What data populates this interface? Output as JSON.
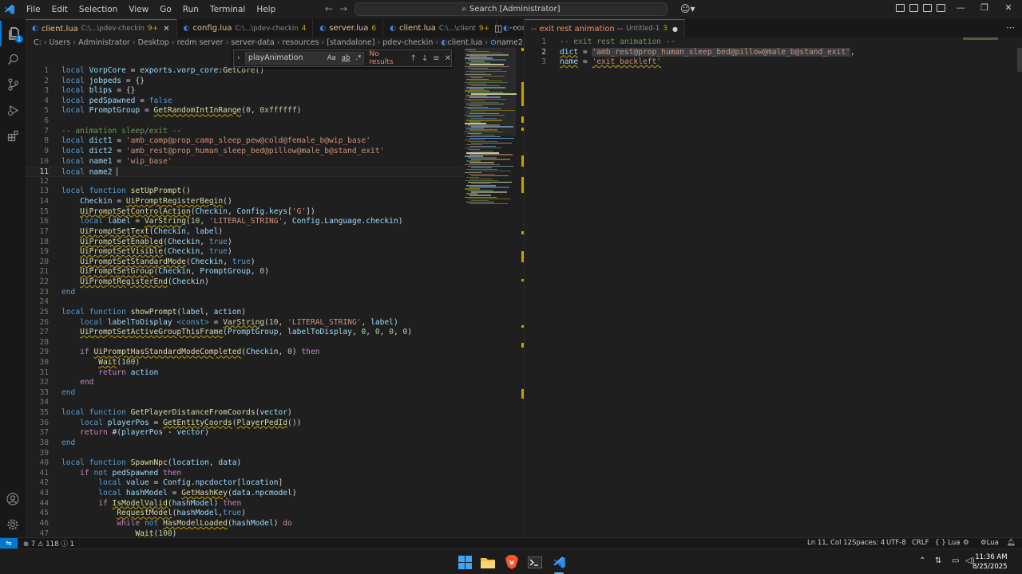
{
  "menu": [
    "File",
    "Edit",
    "Selection",
    "View",
    "Go",
    "Run",
    "Terminal",
    "Help"
  ],
  "search": {
    "text": "Search [Administrator]"
  },
  "activity": {
    "explorer_badge": "1"
  },
  "left_tabs": [
    {
      "name": "client.lua",
      "path": "C:\\...\\pdev-checkin",
      "badge": "9+",
      "active": true,
      "close": "✕"
    },
    {
      "name": "config.lua",
      "path": "C:\\...\\pdev-checkin",
      "badge": "4"
    },
    {
      "name": "server.lua",
      "path": "",
      "badge": "6"
    },
    {
      "name": "client.lua",
      "path": "C:\\...\\client",
      "badge": "9+"
    },
    {
      "name": "config.lua",
      "path": "",
      "badge": ""
    }
  ],
  "right_tab": {
    "name": "-- exit rest animation --",
    "path": "Untitled-1",
    "badge": "3"
  },
  "breadcrumb": [
    "C:",
    "Users",
    "Administrator",
    "Desktop",
    "redm server",
    "server-data",
    "resources",
    "[standalone]",
    "pdev-checkin",
    "client.lua",
    "name2"
  ],
  "find": {
    "query": "playAnimation",
    "opt_case": "Aa",
    "opt_word": "ab",
    "opt_regex": ".*",
    "result": "No results"
  },
  "left_code": [
    {
      "n": "1",
      "t": [
        [
          "k",
          "local "
        ],
        [
          "v",
          "VorpCore"
        ],
        [
          "w",
          " = "
        ],
        [
          "v",
          "exports"
        ],
        [
          "w",
          "."
        ],
        [
          "v",
          "vorp_core"
        ],
        [
          "w",
          ":"
        ],
        [
          "f",
          "GetCore"
        ],
        [
          "w",
          "()"
        ]
      ]
    },
    {
      "n": "2",
      "t": [
        [
          "k",
          "local "
        ],
        [
          "v",
          "jobpeds"
        ],
        [
          "w",
          " = {}"
        ]
      ]
    },
    {
      "n": "3",
      "t": [
        [
          "k",
          "local "
        ],
        [
          "v",
          "blips"
        ],
        [
          "w",
          " = {}"
        ]
      ]
    },
    {
      "n": "4",
      "t": [
        [
          "k",
          "local "
        ],
        [
          "v",
          "pedSpawned"
        ],
        [
          "w",
          " = "
        ],
        [
          "k",
          "false"
        ]
      ]
    },
    {
      "n": "5",
      "t": [
        [
          "k",
          "local "
        ],
        [
          "v",
          "PromptGroup"
        ],
        [
          "w",
          " = "
        ],
        [
          "fu",
          "GetRandomIntInRange"
        ],
        [
          "w",
          "("
        ],
        [
          "n",
          "0"
        ],
        [
          "w",
          ", "
        ],
        [
          "n",
          "0xffffff"
        ],
        [
          "w",
          ")"
        ]
      ]
    },
    {
      "n": "6",
      "t": []
    },
    {
      "n": "7",
      "t": [
        [
          "c",
          "-- animation sleep/exit --"
        ]
      ]
    },
    {
      "n": "8",
      "t": [
        [
          "k",
          "local "
        ],
        [
          "v",
          "dict1"
        ],
        [
          "w",
          " = "
        ],
        [
          "s",
          "'amb_camp@prop_camp_sleep_pew@cold@female_b@wip_base'"
        ]
      ]
    },
    {
      "n": "9",
      "t": [
        [
          "k",
          "local "
        ],
        [
          "v",
          "dict2"
        ],
        [
          "w",
          " = "
        ],
        [
          "s",
          "'amb_rest@prop_human_sleep_bed@pillow@male_b@stand_exit'"
        ]
      ]
    },
    {
      "n": "10",
      "t": [
        [
          "k",
          "local "
        ],
        [
          "v",
          "name1"
        ],
        [
          "w",
          " = "
        ],
        [
          "s",
          "'wip_base'"
        ]
      ]
    },
    {
      "n": "11",
      "t": [
        [
          "k",
          "local "
        ],
        [
          "v",
          "name2"
        ],
        [
          "w",
          " "
        ],
        [
          "cur",
          ""
        ]
      ],
      "current": true
    },
    {
      "n": "12",
      "t": []
    },
    {
      "n": "13",
      "t": [
        [
          "k",
          "local function "
        ],
        [
          "f",
          "setUpPrompt"
        ],
        [
          "w",
          "()"
        ]
      ]
    },
    {
      "n": "14",
      "t": [
        [
          "w",
          "    "
        ],
        [
          "v",
          "Checkin"
        ],
        [
          "w",
          " = "
        ],
        [
          "fu",
          "UiPromptRegisterBegin"
        ],
        [
          "w",
          "()"
        ]
      ]
    },
    {
      "n": "15",
      "t": [
        [
          "w",
          "    "
        ],
        [
          "fu",
          "UiPromptSetControlAction"
        ],
        [
          "w",
          "("
        ],
        [
          "v",
          "Checkin"
        ],
        [
          "w",
          ", "
        ],
        [
          "v",
          "Config"
        ],
        [
          "w",
          "."
        ],
        [
          "v",
          "keys"
        ],
        [
          "w",
          "["
        ],
        [
          "s",
          "'G'"
        ],
        [
          "w",
          "])"
        ]
      ]
    },
    {
      "n": "16",
      "t": [
        [
          "w",
          "    "
        ],
        [
          "k",
          "local "
        ],
        [
          "v",
          "label"
        ],
        [
          "w",
          " = "
        ],
        [
          "fu",
          "VarString"
        ],
        [
          "w",
          "("
        ],
        [
          "n",
          "10"
        ],
        [
          "w",
          ", "
        ],
        [
          "s",
          "'LITERAL_STRING'"
        ],
        [
          "w",
          ", "
        ],
        [
          "v",
          "Config"
        ],
        [
          "w",
          "."
        ],
        [
          "v",
          "Language"
        ],
        [
          "w",
          "."
        ],
        [
          "v",
          "checkin"
        ],
        [
          "w",
          ")"
        ]
      ]
    },
    {
      "n": "17",
      "t": [
        [
          "w",
          "    "
        ],
        [
          "fu",
          "UiPromptSetText"
        ],
        [
          "w",
          "("
        ],
        [
          "v",
          "Checkin"
        ],
        [
          "w",
          ", "
        ],
        [
          "v",
          "label"
        ],
        [
          "w",
          ")"
        ]
      ]
    },
    {
      "n": "18",
      "t": [
        [
          "w",
          "    "
        ],
        [
          "fu",
          "UiPromptSetEnabled"
        ],
        [
          "w",
          "("
        ],
        [
          "v",
          "Checkin"
        ],
        [
          "w",
          ", "
        ],
        [
          "k",
          "true"
        ],
        [
          "w",
          ")"
        ]
      ]
    },
    {
      "n": "19",
      "t": [
        [
          "w",
          "    "
        ],
        [
          "fu",
          "UiPromptSetVisible"
        ],
        [
          "w",
          "("
        ],
        [
          "v",
          "Checkin"
        ],
        [
          "w",
          ", "
        ],
        [
          "k",
          "true"
        ],
        [
          "w",
          ")"
        ]
      ]
    },
    {
      "n": "20",
      "t": [
        [
          "w",
          "    "
        ],
        [
          "fu",
          "UiPromptSetStandardMode"
        ],
        [
          "w",
          "("
        ],
        [
          "v",
          "Checkin"
        ],
        [
          "w",
          ", "
        ],
        [
          "k",
          "true"
        ],
        [
          "w",
          ")"
        ]
      ]
    },
    {
      "n": "21",
      "t": [
        [
          "w",
          "    "
        ],
        [
          "fu",
          "UiPromptSetGroup"
        ],
        [
          "w",
          "("
        ],
        [
          "v",
          "Checkin"
        ],
        [
          "w",
          ", "
        ],
        [
          "v",
          "PromptGroup"
        ],
        [
          "w",
          ", "
        ],
        [
          "n",
          "0"
        ],
        [
          "w",
          ")"
        ]
      ]
    },
    {
      "n": "22",
      "t": [
        [
          "w",
          "    "
        ],
        [
          "fu",
          "UiPromptRegisterEnd"
        ],
        [
          "w",
          "("
        ],
        [
          "v",
          "Checkin"
        ],
        [
          "w",
          ")"
        ]
      ]
    },
    {
      "n": "23",
      "t": [
        [
          "k",
          "end"
        ]
      ]
    },
    {
      "n": "24",
      "t": []
    },
    {
      "n": "25",
      "t": [
        [
          "k",
          "local function "
        ],
        [
          "f",
          "showPrompt"
        ],
        [
          "w",
          "("
        ],
        [
          "v",
          "label"
        ],
        [
          "w",
          ", "
        ],
        [
          "v",
          "action"
        ],
        [
          "w",
          ")"
        ]
      ]
    },
    {
      "n": "26",
      "t": [
        [
          "w",
          "    "
        ],
        [
          "k",
          "local "
        ],
        [
          "v",
          "labelToDisplay"
        ],
        [
          "w",
          " "
        ],
        [
          "k",
          "<const>"
        ],
        [
          "w",
          " = "
        ],
        [
          "fu",
          "VarString"
        ],
        [
          "w",
          "("
        ],
        [
          "n",
          "10"
        ],
        [
          "w",
          ", "
        ],
        [
          "s",
          "'LITERAL_STRING'"
        ],
        [
          "w",
          ", "
        ],
        [
          "v",
          "label"
        ],
        [
          "w",
          ")"
        ]
      ]
    },
    {
      "n": "27",
      "t": [
        [
          "w",
          "    "
        ],
        [
          "fu",
          "UiPromptSetActiveGroupThisFrame"
        ],
        [
          "w",
          "("
        ],
        [
          "v",
          "PromptGroup"
        ],
        [
          "w",
          ", "
        ],
        [
          "v",
          "labelToDisplay"
        ],
        [
          "w",
          ", "
        ],
        [
          "n",
          "0"
        ],
        [
          "w",
          ", "
        ],
        [
          "n",
          "0"
        ],
        [
          "w",
          ", "
        ],
        [
          "n",
          "0"
        ],
        [
          "w",
          ", "
        ],
        [
          "n",
          "0"
        ],
        [
          "w",
          ")"
        ]
      ]
    },
    {
      "n": "28",
      "t": []
    },
    {
      "n": "29",
      "t": [
        [
          "w",
          "    "
        ],
        [
          "kc",
          "if "
        ],
        [
          "fu",
          "UiPromptHasStandardModeCompleted"
        ],
        [
          "w",
          "("
        ],
        [
          "v",
          "Checkin"
        ],
        [
          "w",
          ", "
        ],
        [
          "n",
          "0"
        ],
        [
          "w",
          ") "
        ],
        [
          "kc",
          "then"
        ]
      ]
    },
    {
      "n": "30",
      "t": [
        [
          "w",
          "        "
        ],
        [
          "fu",
          "Wait"
        ],
        [
          "w",
          "("
        ],
        [
          "n",
          "100"
        ],
        [
          "w",
          ")"
        ]
      ]
    },
    {
      "n": "31",
      "t": [
        [
          "w",
          "        "
        ],
        [
          "kc",
          "return "
        ],
        [
          "v",
          "action"
        ]
      ]
    },
    {
      "n": "32",
      "t": [
        [
          "w",
          "    "
        ],
        [
          "kc",
          "end"
        ]
      ]
    },
    {
      "n": "33",
      "t": [
        [
          "k",
          "end"
        ]
      ]
    },
    {
      "n": "34",
      "t": []
    },
    {
      "n": "35",
      "t": [
        [
          "k",
          "local function "
        ],
        [
          "f",
          "GetPlayerDistanceFromCoords"
        ],
        [
          "w",
          "("
        ],
        [
          "v",
          "vector"
        ],
        [
          "w",
          ")"
        ]
      ]
    },
    {
      "n": "36",
      "t": [
        [
          "w",
          "    "
        ],
        [
          "k",
          "local "
        ],
        [
          "v",
          "playerPos"
        ],
        [
          "w",
          " = "
        ],
        [
          "fu",
          "GetEntityCoords"
        ],
        [
          "w",
          "("
        ],
        [
          "fu",
          "PlayerPedId"
        ],
        [
          "w",
          "())"
        ]
      ]
    },
    {
      "n": "37",
      "t": [
        [
          "w",
          "    "
        ],
        [
          "kc",
          "return "
        ],
        [
          "w",
          "#("
        ],
        [
          "v",
          "playerPos"
        ],
        [
          "w",
          " - "
        ],
        [
          "v",
          "vector"
        ],
        [
          "w",
          ")"
        ]
      ]
    },
    {
      "n": "38",
      "t": [
        [
          "k",
          "end"
        ]
      ]
    },
    {
      "n": "39",
      "t": []
    },
    {
      "n": "40",
      "t": [
        [
          "k",
          "local function "
        ],
        [
          "f",
          "SpawnNpc"
        ],
        [
          "w",
          "("
        ],
        [
          "v",
          "location"
        ],
        [
          "w",
          ", "
        ],
        [
          "v",
          "data"
        ],
        [
          "w",
          ")"
        ]
      ]
    },
    {
      "n": "41",
      "t": [
        [
          "w",
          "    "
        ],
        [
          "kc",
          "if "
        ],
        [
          "k",
          "not "
        ],
        [
          "v",
          "pedSpawned"
        ],
        [
          "w",
          " "
        ],
        [
          "kc",
          "then"
        ]
      ]
    },
    {
      "n": "42",
      "t": [
        [
          "w",
          "        "
        ],
        [
          "k",
          "local "
        ],
        [
          "v",
          "value"
        ],
        [
          "w",
          " = "
        ],
        [
          "v",
          "Config"
        ],
        [
          "w",
          "."
        ],
        [
          "v",
          "npcdoctor"
        ],
        [
          "w",
          "["
        ],
        [
          "v",
          "location"
        ],
        [
          "w",
          "]"
        ]
      ]
    },
    {
      "n": "43",
      "t": [
        [
          "w",
          "        "
        ],
        [
          "k",
          "local "
        ],
        [
          "v",
          "hashModel"
        ],
        [
          "w",
          " = "
        ],
        [
          "fu",
          "GetHashKey"
        ],
        [
          "w",
          "("
        ],
        [
          "v",
          "data"
        ],
        [
          "w",
          "."
        ],
        [
          "v",
          "npcmodel"
        ],
        [
          "w",
          ")"
        ]
      ]
    },
    {
      "n": "44",
      "t": [
        [
          "w",
          "        "
        ],
        [
          "kc",
          "if "
        ],
        [
          "fu",
          "IsModelValid"
        ],
        [
          "w",
          "("
        ],
        [
          "v",
          "hashModel"
        ],
        [
          "w",
          ") "
        ],
        [
          "kc",
          "then"
        ]
      ]
    },
    {
      "n": "45",
      "t": [
        [
          "w",
          "            "
        ],
        [
          "fu",
          "RequestModel"
        ],
        [
          "w",
          "("
        ],
        [
          "v",
          "hashModel"
        ],
        [
          "w",
          ","
        ],
        [
          "k",
          "true"
        ],
        [
          "w",
          ")"
        ]
      ]
    },
    {
      "n": "46",
      "t": [
        [
          "w",
          "            "
        ],
        [
          "kc",
          "while "
        ],
        [
          "k",
          "not "
        ],
        [
          "fu",
          "HasModelLoaded"
        ],
        [
          "w",
          "("
        ],
        [
          "v",
          "hashModel"
        ],
        [
          "w",
          ") "
        ],
        [
          "kc",
          "do"
        ]
      ]
    },
    {
      "n": "47",
      "t": [
        [
          "w",
          "                "
        ],
        [
          "fu",
          "Wait"
        ],
        [
          "w",
          "("
        ],
        [
          "n",
          "100"
        ],
        [
          "w",
          ")"
        ]
      ]
    }
  ],
  "right_code": [
    {
      "n": "1",
      "t": [
        [
          "c",
          "-- exit rest animation --"
        ]
      ]
    },
    {
      "n": "2",
      "t": [
        [
          "vu",
          "dict"
        ],
        [
          "w",
          " = "
        ],
        [
          "sh",
          "'amb_rest@prop_human_sleep_bed@pillow@male_b@stand_exit'"
        ],
        [
          "w",
          ","
        ]
      ],
      "current": true
    },
    {
      "n": "3",
      "t": [
        [
          "vu",
          "name"
        ],
        [
          "w",
          " = "
        ],
        [
          "su",
          "'exit_backleft'"
        ]
      ]
    }
  ],
  "status": {
    "problems_errors": "7",
    "problems_warnings": "118",
    "info": "1",
    "position": "Ln 11, Col 12",
    "spaces": "Spaces: 4",
    "encoding": "UTF-8",
    "eol": "CRLF",
    "braces": "{ }",
    "language": "Lua",
    "lang_status": "Lua"
  },
  "clock": {
    "time": "11:36 AM",
    "date": "8/25/2025"
  },
  "colors": {
    "accent": "#0078d4",
    "warning": "#c5a100",
    "editor_bg": "#1f1f1f"
  }
}
